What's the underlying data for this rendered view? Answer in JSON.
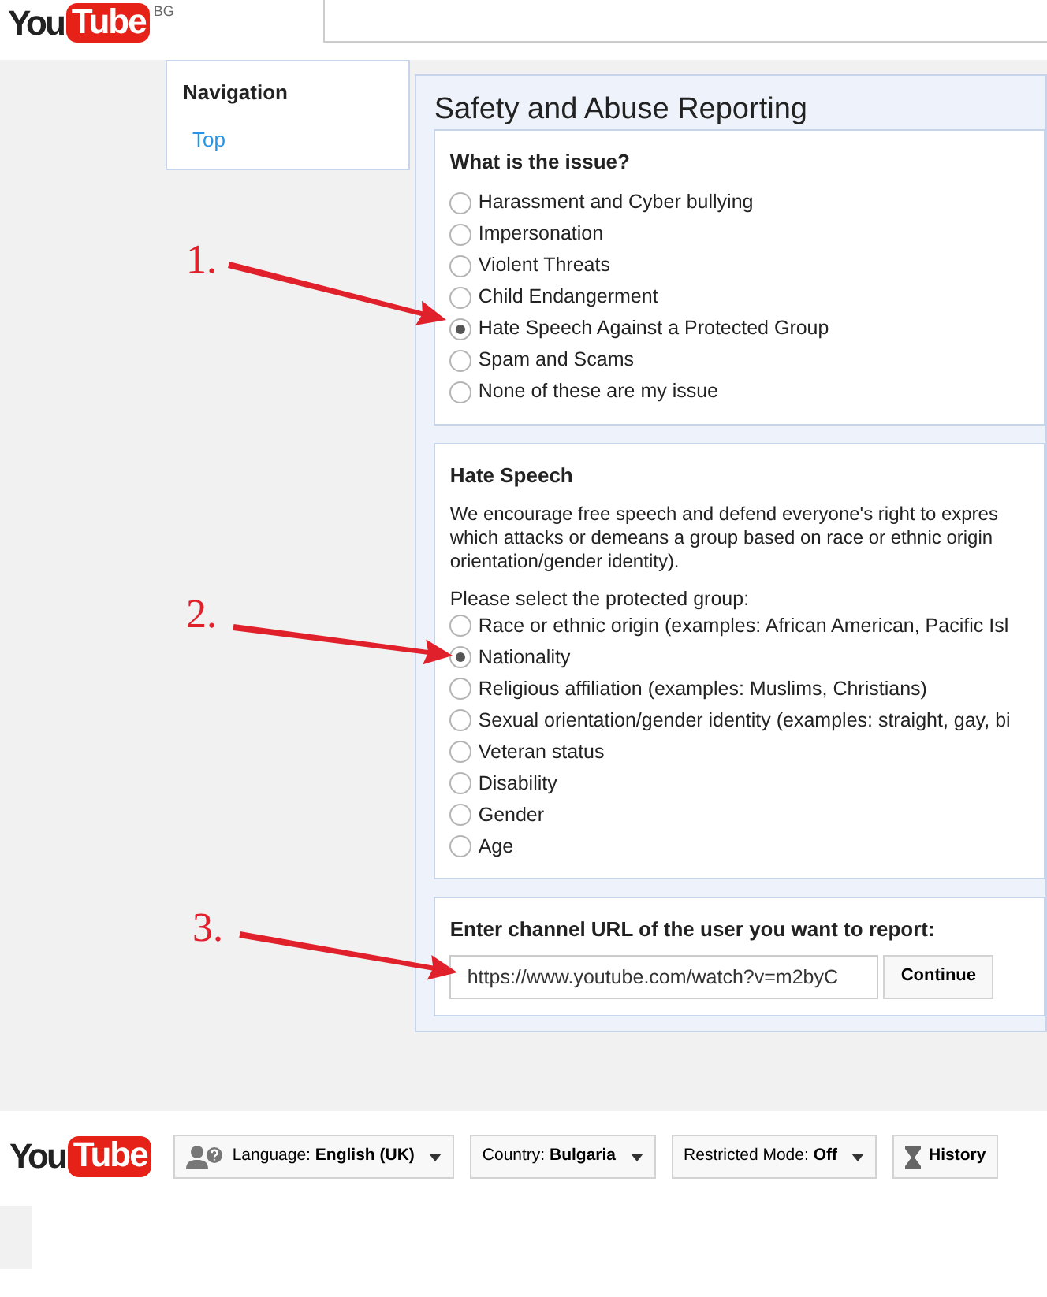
{
  "header": {
    "logo_left": "You",
    "logo_right": "Tube",
    "region": "BG"
  },
  "navigation": {
    "title": "Navigation",
    "items": [
      {
        "label": "Top"
      }
    ]
  },
  "panel": {
    "title": "Safety and Abuse Reporting",
    "issue": {
      "title": "What is the issue?",
      "options": [
        {
          "label": "Harassment and Cyber bullying",
          "selected": false
        },
        {
          "label": "Impersonation",
          "selected": false
        },
        {
          "label": "Violent Threats",
          "selected": false
        },
        {
          "label": "Child Endangerment",
          "selected": false
        },
        {
          "label": "Hate Speech Against a Protected Group",
          "selected": true
        },
        {
          "label": "Spam and Scams",
          "selected": false
        },
        {
          "label": "None of these are my issue",
          "selected": false
        }
      ]
    },
    "hate_speech": {
      "title": "Hate Speech",
      "description_lines": [
        "We encourage free speech and defend everyone's right to expres",
        "which attacks or demeans a group based on race or ethnic origin",
        "orientation/gender identity)."
      ],
      "prompt": "Please select the protected group:",
      "options": [
        {
          "label": "Race or ethnic origin (examples: African American, Pacific Isl",
          "selected": false
        },
        {
          "label": "Nationality",
          "selected": true
        },
        {
          "label": "Religious affiliation (examples: Muslims, Christians)",
          "selected": false
        },
        {
          "label": "Sexual orientation/gender identity (examples: straight, gay, bi",
          "selected": false
        },
        {
          "label": "Veteran status",
          "selected": false
        },
        {
          "label": "Disability",
          "selected": false
        },
        {
          "label": "Gender",
          "selected": false
        },
        {
          "label": "Age",
          "selected": false
        }
      ]
    },
    "channel": {
      "title": "Enter channel URL of the user you want to report:",
      "url": "https://www.youtube.com/watch?v=m2byC",
      "button": "Continue"
    }
  },
  "annotations": [
    {
      "label": "1."
    },
    {
      "label": "2."
    },
    {
      "label": "3."
    }
  ],
  "footer": {
    "logo_left": "You",
    "logo_right": "Tube",
    "buttons": [
      {
        "kind": "language",
        "prefix": "Language:",
        "value": "English (UK)"
      },
      {
        "kind": "country",
        "prefix": "Country:",
        "value": "Bulgaria"
      },
      {
        "kind": "restricted",
        "prefix": "Restricted Mode:",
        "value": "Off"
      },
      {
        "kind": "history",
        "value": "History"
      }
    ]
  }
}
